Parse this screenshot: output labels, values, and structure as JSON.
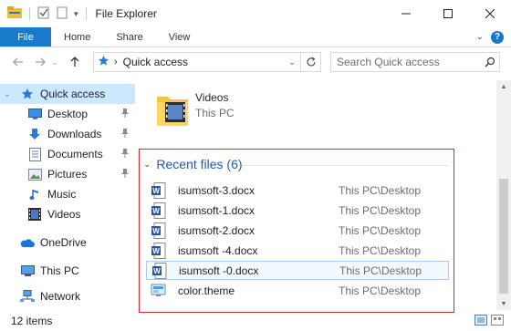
{
  "window": {
    "title": "File Explorer"
  },
  "ribbon": {
    "tabs": [
      "File",
      "Home",
      "Share",
      "View"
    ]
  },
  "address": {
    "location": "Quick access",
    "search_placeholder": "Search Quick access"
  },
  "sidebar": {
    "items": [
      {
        "label": "Quick access",
        "icon": "star-icon",
        "selected": true
      },
      {
        "label": "Desktop",
        "icon": "desktop-icon",
        "pinned": true
      },
      {
        "label": "Downloads",
        "icon": "download-icon",
        "pinned": true
      },
      {
        "label": "Documents",
        "icon": "documents-icon",
        "pinned": true
      },
      {
        "label": "Pictures",
        "icon": "pictures-icon",
        "pinned": true
      },
      {
        "label": "Music",
        "icon": "music-icon"
      },
      {
        "label": "Videos",
        "icon": "videos-icon"
      },
      {
        "label": "OneDrive",
        "icon": "onedrive-icon"
      },
      {
        "label": "This PC",
        "icon": "pc-icon"
      },
      {
        "label": "Network",
        "icon": "network-icon"
      }
    ]
  },
  "main": {
    "folder": {
      "name": "Videos",
      "location": "This PC"
    },
    "recent_group": {
      "header": "Recent files (6)",
      "files": [
        {
          "name": "isumsoft-3.docx",
          "location": "This PC\\Desktop",
          "icon": "word-doc-icon"
        },
        {
          "name": "isumsoft-1.docx",
          "location": "This PC\\Desktop",
          "icon": "word-doc-icon"
        },
        {
          "name": "isumsoft-2.docx",
          "location": "This PC\\Desktop",
          "icon": "word-doc-icon"
        },
        {
          "name": "isumsoft -4.docx",
          "location": "This PC\\Desktop",
          "icon": "word-doc-icon"
        },
        {
          "name": "isumsoft -0.docx",
          "location": "This PC\\Desktop",
          "icon": "word-doc-icon",
          "hovered": true
        },
        {
          "name": "color.theme",
          "location": "This PC\\Desktop",
          "icon": "theme-file-icon"
        }
      ]
    }
  },
  "status": {
    "count": "12 items"
  },
  "colors": {
    "accent": "#1979ca",
    "selection": "#cce8ff",
    "highlight_box": "#cc2b2b",
    "group_header": "#1e5aa8"
  }
}
